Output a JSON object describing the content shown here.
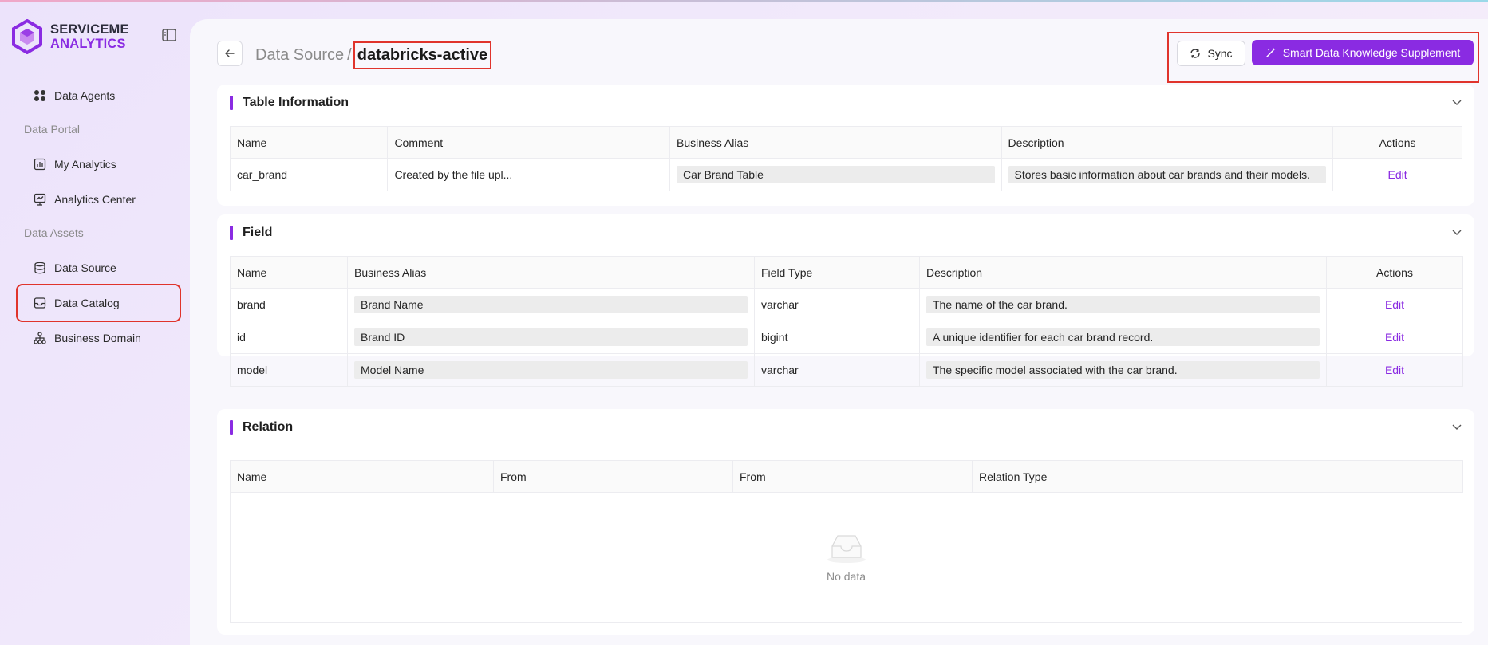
{
  "brand": {
    "line1": "SERVICEME",
    "line2": "ANALYTICS"
  },
  "sidebar": {
    "items": [
      {
        "label": "Data Agents",
        "icon": "grid-icon"
      },
      {
        "group": "Data Portal"
      },
      {
        "label": "My Analytics",
        "icon": "chart-icon"
      },
      {
        "label": "Analytics Center",
        "icon": "board-icon"
      },
      {
        "group": "Data Assets"
      },
      {
        "label": "Data Source",
        "icon": "database-icon"
      },
      {
        "label": "Data Catalog",
        "icon": "inbox-icon",
        "active": true
      },
      {
        "label": "Business Domain",
        "icon": "hierarchy-icon"
      }
    ]
  },
  "header": {
    "parent": "Data Source",
    "separator": "/",
    "current": "databricks-active",
    "sync_label": "Sync",
    "smart_label": "Smart Data Knowledge Supplement"
  },
  "table_info": {
    "title": "Table Information",
    "columns": [
      "Name",
      "Comment",
      "Business Alias",
      "Description",
      "Actions"
    ],
    "rows": [
      {
        "name": "car_brand",
        "comment": "Created by the file upl...",
        "alias": "Car Brand Table",
        "description": "Stores basic information about car brands and their models.",
        "action": "Edit"
      }
    ]
  },
  "fields": {
    "title": "Field",
    "columns": [
      "Name",
      "Business Alias",
      "Field Type",
      "Description",
      "Actions"
    ],
    "rows": [
      {
        "name": "brand",
        "alias": "Brand Name",
        "type": "varchar",
        "description": "The name of the car brand.",
        "action": "Edit"
      },
      {
        "name": "id",
        "alias": "Brand ID",
        "type": "bigint",
        "description": "A unique identifier for each car brand record.",
        "action": "Edit"
      },
      {
        "name": "model",
        "alias": "Model Name",
        "type": "varchar",
        "description": "The specific model associated with the car brand.",
        "action": "Edit"
      }
    ]
  },
  "relation": {
    "title": "Relation",
    "columns": [
      "Name",
      "From",
      "From",
      "Relation Type"
    ],
    "empty_text": "No data"
  },
  "colors": {
    "accent": "#8a2be2",
    "highlight": "#e0342c"
  }
}
